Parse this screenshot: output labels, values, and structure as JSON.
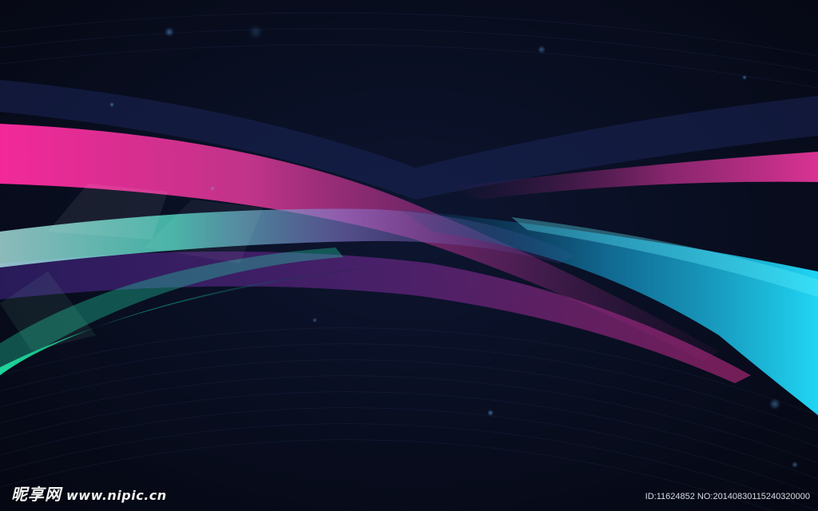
{
  "watermark": {
    "brand": "昵享网",
    "url": "www.nipic.cn",
    "id_text": "ID:11624852 NO:20140830115240320000"
  },
  "palette": {
    "background": "#060a1a",
    "magenta": "#ff2aa0",
    "cyan": "#1fd6f0",
    "teal": "#3fe8c0",
    "green": "#1ee098",
    "violet": "#6a2fa8"
  }
}
